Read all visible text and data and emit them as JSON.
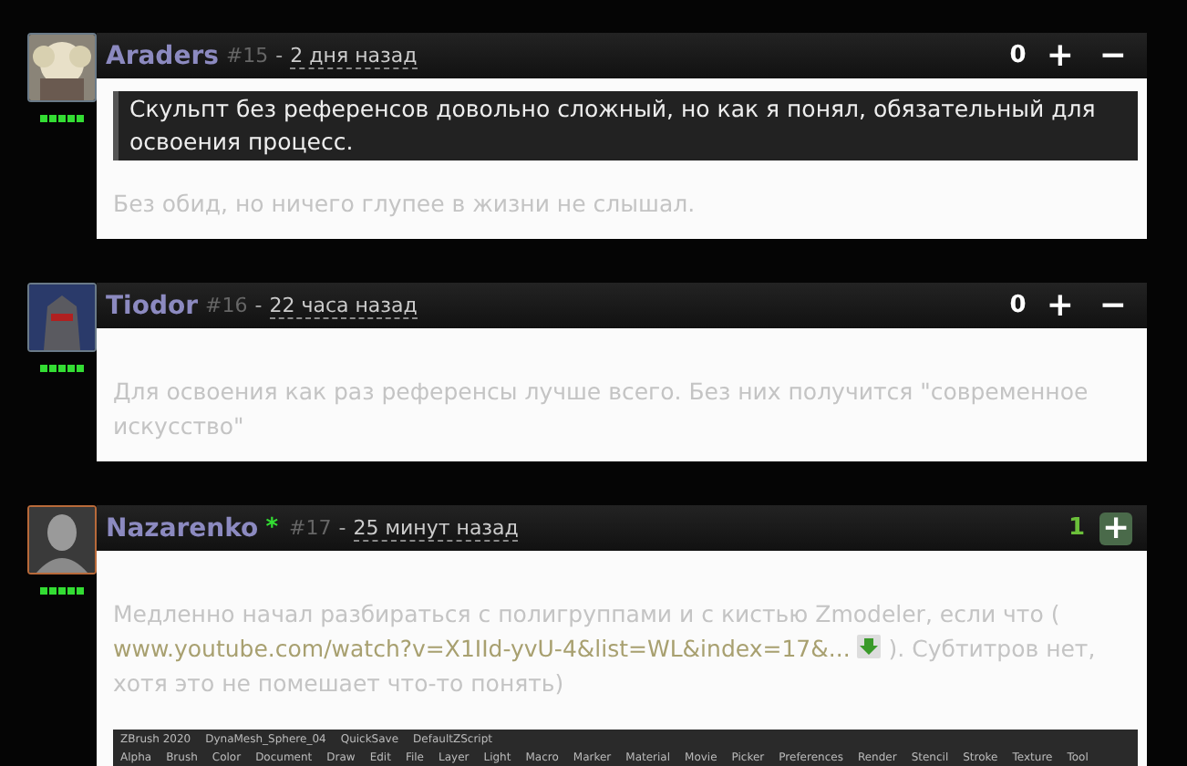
{
  "comments": [
    {
      "author": "Araders",
      "online": false,
      "number": "#15",
      "separator": "-",
      "time": "2 дня назад",
      "rating": "0",
      "rating_positive": false,
      "plus": "+",
      "minus": "−",
      "quote": "Скульпт без референсов довольно сложный, но как я понял, обязательный для освоения процесс.",
      "paragraphs": [
        {
          "parts": [
            {
              "kind": "text",
              "text": "Без обид, но ничего глупее в жизни не слышал."
            }
          ]
        }
      ]
    },
    {
      "author": "Tiodor",
      "online": false,
      "number": "#16",
      "separator": "-",
      "time": "22 часа назад",
      "rating": "0",
      "rating_positive": false,
      "plus": "+",
      "minus": "−",
      "paragraphs": [
        {
          "parts": [
            {
              "kind": "text",
              "text": "Для освоения как раз референсы лучше всего. Без них получится \"современное искусство\""
            }
          ]
        }
      ]
    },
    {
      "author": "Nazarenko",
      "online": true,
      "online_mark": "*",
      "number": "#17",
      "separator": "-",
      "time": "25 минут назад",
      "rating": "1",
      "rating_positive": true,
      "plus": "+",
      "paragraphs": [
        {
          "parts": [
            {
              "kind": "text",
              "text": "Медленно начал разбираться с полигруппами и с кистью Zmodeler, если что ("
            },
            {
              "kind": "link",
              "text": "www.youtube.com/watch?v=X1IId-yvU-4&list=WL&index=17&..."
            },
            {
              "kind": "download"
            },
            {
              "kind": "text",
              "text": "). Субтитров нет, хотя это не помешает что-то понять)"
            }
          ]
        }
      ],
      "screenshot": {
        "title_items": [
          "ZBrush 2020",
          "DynaMesh_Sphere_04",
          "QuickSave",
          "DefaultZScript"
        ],
        "menu": [
          "Alpha",
          "Brush",
          "Color",
          "Document",
          "Draw",
          "Edit",
          "File",
          "Layer",
          "Light",
          "Macro",
          "Marker",
          "Material",
          "Movie",
          "Picker",
          "Preferences",
          "Render",
          "Stencil",
          "Stroke",
          "Texture",
          "Tool"
        ]
      }
    }
  ]
}
